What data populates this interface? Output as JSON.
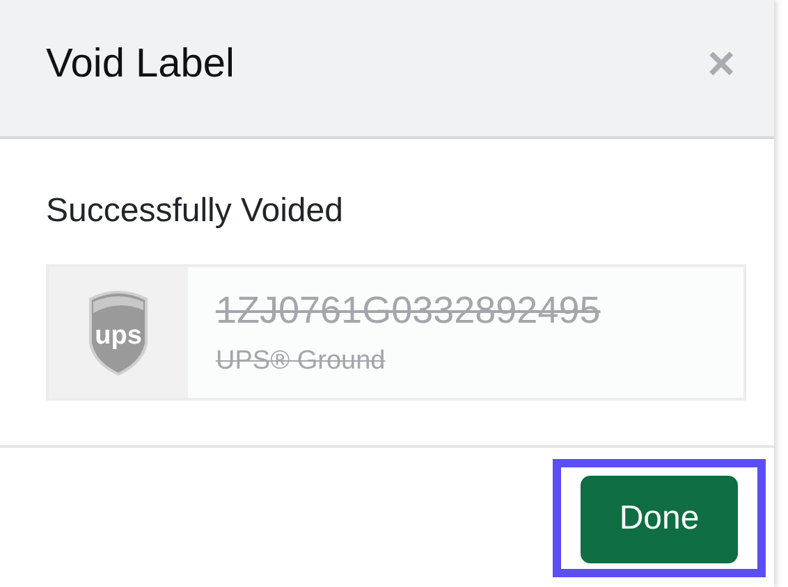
{
  "dialog": {
    "title": "Void Label",
    "close": "×"
  },
  "message": "Successfully Voided",
  "label": {
    "logo_text": "ups",
    "tracking_number": "1ZJ0761G0332892495",
    "service": "UPS® Ground",
    "voided": true
  },
  "buttons": [
    {
      "label": "Done",
      "highlighted": true
    }
  ]
}
